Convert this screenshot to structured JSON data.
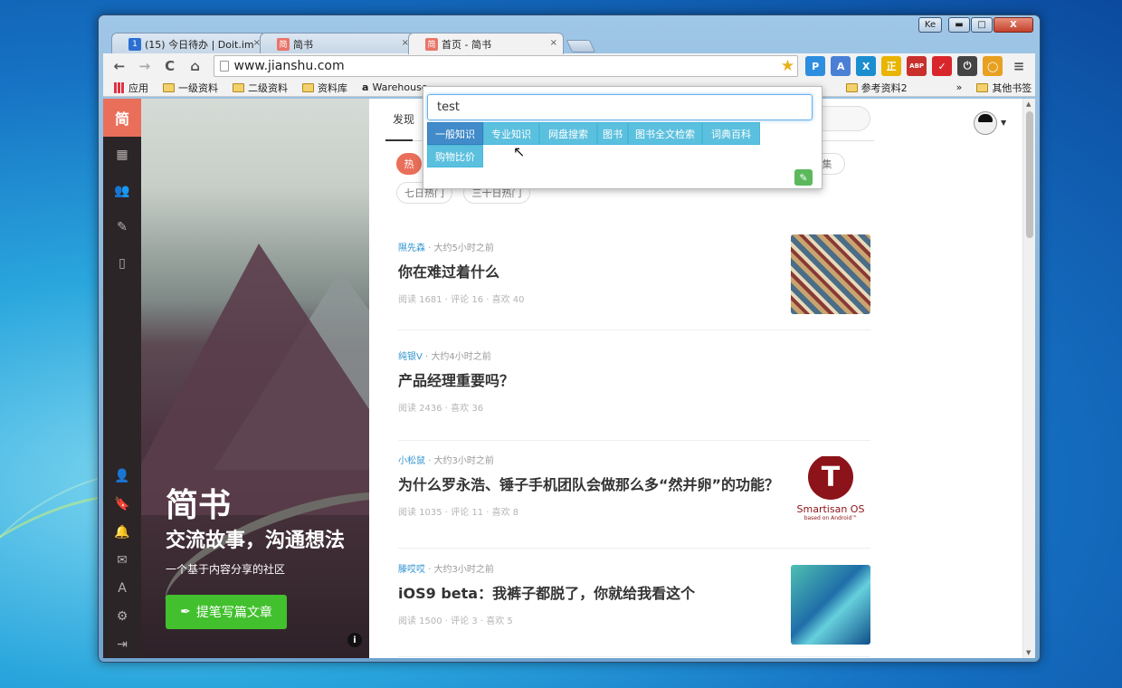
{
  "window": {
    "user_badge": "Ke",
    "min_glyph": "▬",
    "max_glyph": "□",
    "close_glyph": "X"
  },
  "tabs": [
    {
      "label": "(15) 今日待办 | Doit.im",
      "favicon": "1",
      "close": "×"
    },
    {
      "label": "简书",
      "favicon": "简",
      "close": "×"
    },
    {
      "label": "首页 - 简书",
      "favicon": "简",
      "close": "×"
    }
  ],
  "toolbar": {
    "back": "←",
    "forward": "→",
    "reload": "C",
    "home": "⌂",
    "url": "www.jianshu.com",
    "star": "★",
    "menu": "≡"
  },
  "extensions": [
    {
      "name": "search-extension-icon",
      "glyph": "P",
      "color": "#2d8ee0"
    },
    {
      "name": "translate-icon",
      "glyph": "A",
      "color": "#4a7fd6"
    },
    {
      "name": "x-extension-icon",
      "glyph": "X",
      "color": "#1a8ecf"
    },
    {
      "name": "zhi-extension-icon",
      "glyph": "正",
      "color": "#e8b400"
    },
    {
      "name": "adblock-icon",
      "glyph": "ABP",
      "color": "#c9302c"
    },
    {
      "name": "check-extension-icon",
      "glyph": "✓",
      "color": "#d9262c"
    },
    {
      "name": "power-icon",
      "glyph": "⏻",
      "color": "#444"
    },
    {
      "name": "ring-extension-icon",
      "glyph": "◯",
      "color": "#e8a020"
    }
  ],
  "bookmarks": {
    "apps": "应用",
    "items": [
      "一级资料",
      "二级资料",
      "资料库",
      "Warehouse",
      "参考资料2"
    ],
    "overflow": "»",
    "other": "其他书签"
  },
  "sidebar": {
    "logo": "简",
    "top_icons": [
      "▦",
      "👥",
      "✎",
      "▯"
    ],
    "bottom_icons": [
      "👤",
      "🔖",
      "🔔",
      "✉",
      "A",
      "⚙",
      "⇥"
    ]
  },
  "hero": {
    "title": "简书",
    "slogan": "交流故事，沟通想法",
    "subtitle": "一个基于内容分享的社区",
    "write_button": "提笔写篇文章",
    "info": "i"
  },
  "content": {
    "nav_tab": "发现",
    "filters": [
      "热",
      "集",
      "七日热门",
      "三十日热门"
    ]
  },
  "articles": [
    {
      "author": "隰先森",
      "time": "· 大约5小时之前",
      "title": "你在难过着什么",
      "stats": "阅读 1681 · 评论 16 · 喜欢 40"
    },
    {
      "author": "纯银V",
      "time": "· 大约4小时之前",
      "title": "产品经理重要吗？",
      "stats": "阅读 2436 · 喜欢 36"
    },
    {
      "author": "小松鼠",
      "time": "· 大约3小时之前",
      "title": "为什么罗永浩、锤子手机团队会做那么多“然并卵”的功能？",
      "stats": "阅读 1035 · 评论 11 · 喜欢 8",
      "thumb_logo": "T",
      "thumb_brand": "Smartisan OS",
      "thumb_sub": "based on Android™"
    },
    {
      "author": "滕哎哎",
      "time": "· 大约3小时之前",
      "title": "iOS9 beta：我裤子都脱了，你就给我看这个",
      "stats": "阅读 1500 · 评论 3 · 喜欢 5"
    }
  ],
  "popup": {
    "query": "test",
    "categories": [
      "一般知识",
      "专业知识",
      "网盘搜索",
      "图书",
      "图书全文检索",
      "词典百科",
      "购物比价"
    ],
    "settings": "✎"
  }
}
